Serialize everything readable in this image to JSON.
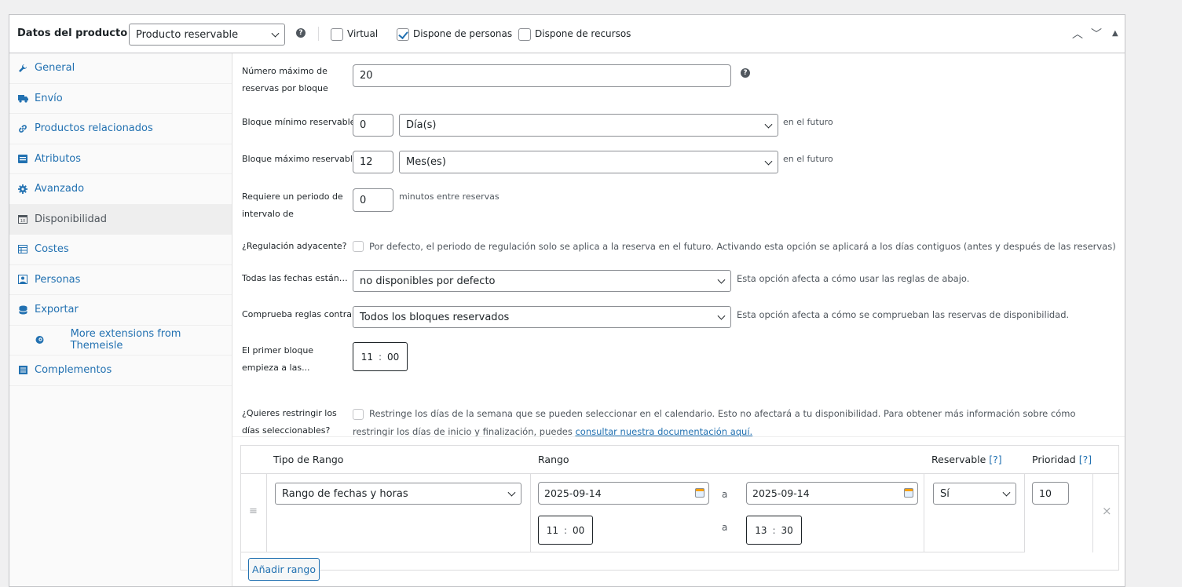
{
  "header": {
    "title": "Datos del producto —",
    "product_type": "Producto reservable",
    "virtual_label": "Virtual",
    "virtual_checked": false,
    "persons_label": "Dispone de personas",
    "persons_checked": true,
    "resources_label": "Dispone de recursos",
    "resources_checked": false
  },
  "sidebar": {
    "items": [
      {
        "label": "General",
        "icon": "wrench-icon"
      },
      {
        "label": "Envío",
        "icon": "truck-icon"
      },
      {
        "label": "Productos relacionados",
        "icon": "link-icon"
      },
      {
        "label": "Atributos",
        "icon": "list-icon"
      },
      {
        "label": "Avanzado",
        "icon": "gear-icon"
      },
      {
        "label": "Disponibilidad",
        "icon": "calendar-icon",
        "active": true
      },
      {
        "label": "Costes",
        "icon": "table-icon"
      },
      {
        "label": "Personas",
        "icon": "person-icon"
      },
      {
        "label": "Exportar",
        "icon": "export-icon"
      },
      {
        "label": "More extensions from Themeisle",
        "icon": "themeisle-icon"
      },
      {
        "label": "Complementos",
        "icon": "menu-icon"
      }
    ]
  },
  "fields": {
    "max_label": "Número máximo de reservas por bloque",
    "max_value": "20",
    "min_block_label": "Bloque mínimo reservable",
    "min_block_value": "0",
    "min_block_unit": "Día(s)",
    "min_block_suffix": "en el futuro",
    "max_block_label": "Bloque máximo reservable",
    "max_block_value": "12",
    "max_block_unit": "Mes(es)",
    "max_block_suffix": "en el futuro",
    "buffer_label": "Requiere un periodo de intervalo de",
    "buffer_value": "0",
    "buffer_suffix": "minutos entre reservas",
    "adjacent_label": "¿Regulación adyacente?",
    "adjacent_desc": "Por defecto, el periodo de regulación solo se aplica a la reserva en el futuro. Activando esta opción se aplicará a los días contiguos (antes y después de las reservas)",
    "all_dates_label": "Todas las fechas están…",
    "all_dates_value": "no disponibles por defecto",
    "all_dates_desc": "Esta opción afecta a cómo usar las reglas de abajo.",
    "check_rules_label": "Comprueba reglas contra …",
    "check_rules_value": "Todos los bloques reservados",
    "check_rules_desc": "Esta opción afecta a cómo se comprueban las reservas de disponibilidad.",
    "first_block_label": "El primer bloque empieza a las...",
    "first_block_hour": "11",
    "first_block_min": "00",
    "restrict_label": "¿Quieres restringir los días seleccionables?",
    "restrict_desc": "Restringe los días de la semana que se pueden seleccionar en el calendario. Esto no afectará a tu disponibilidad. Para obtener más información sobre cómo restringir los días de inicio y finalización, puedes",
    "restrict_link": "consultar nuestra documentación aquí."
  },
  "table": {
    "col_type": "Tipo de Rango",
    "col_range": "Rango",
    "col_bookable": "Reservable",
    "col_priority": "Prioridad",
    "help_mark": "[?]",
    "row": {
      "type": "Rango de fechas y horas",
      "from_date": "2025-09-14",
      "to_date": "2025-09-14",
      "sep": "a",
      "from_hour": "11",
      "from_min": "00",
      "to_hour": "13",
      "to_min": "30",
      "bookable": "Sí",
      "priority": "10",
      "remove": "×",
      "handle": "≡"
    },
    "add_button": "Añadir rango"
  }
}
